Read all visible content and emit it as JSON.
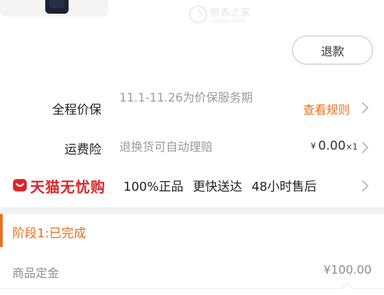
{
  "watermark": {
    "cn": "腕表之家",
    "en": "xbiao.com"
  },
  "actions": {
    "refund_label": "退款"
  },
  "price_protection": {
    "label": "全程价保",
    "desc": "11.1-11.26为价保服务期",
    "link": "查看规则"
  },
  "shipping_insurance": {
    "label": "运费险",
    "desc": "退换货可自动理赔",
    "currency": "¥",
    "price": "0.00",
    "qty": "×1"
  },
  "tmall": {
    "brand": "天猫无忧购",
    "features": "100%正品 更快送达 48小时售后",
    "brand_color": "#e0232a"
  },
  "stage": {
    "label": "阶段1:已完成",
    "accent_color": "#f06d1a"
  },
  "deposit": {
    "label": "商品定金",
    "value": "¥100.00"
  }
}
